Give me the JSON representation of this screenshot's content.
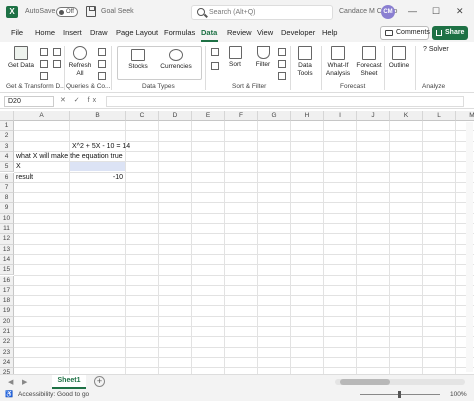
{
  "titlebar": {
    "autosave_label": "AutoSave",
    "autosave_state": "Off",
    "doc_title": "Goal Seek",
    "search_placeholder": "Search (Alt+Q)",
    "user_name": "Candace M Castro",
    "avatar_initials": "CM"
  },
  "tabs": [
    "File",
    "Home",
    "Insert",
    "Draw",
    "Page Layout",
    "Formulas",
    "Data",
    "Review",
    "View",
    "Developer",
    "Help"
  ],
  "active_tab": "Data",
  "actions": {
    "comments": "Comments",
    "share": "Share"
  },
  "ribbon": {
    "get_data": "Get Data",
    "refresh_all": "Refresh All",
    "stocks": "Stocks",
    "currencies": "Currencies",
    "sort": "Sort",
    "filter": "Filter",
    "data_tools": "Data Tools",
    "what_if": "What-If Analysis",
    "forecast_sheet": "Forecast Sheet",
    "outline": "Outline",
    "solver": "Solver",
    "groups": {
      "get_transform": "Get & Transform D...",
      "queries": "Queries & Co...",
      "data_types": "Data Types",
      "sort_filter": "Sort & Filter",
      "forecast": "Forecast",
      "analyze": "Analyze"
    }
  },
  "formula_bar": {
    "name_box": "D20",
    "content": ""
  },
  "columns": [
    "A",
    "B",
    "C",
    "D",
    "E",
    "F",
    "G",
    "H",
    "I",
    "J",
    "K",
    "L",
    "M"
  ],
  "rows": [
    "1",
    "2",
    "3",
    "4",
    "5",
    "6",
    "7",
    "8",
    "9",
    "10",
    "11",
    "12",
    "13",
    "14",
    "15",
    "16",
    "17",
    "18",
    "19",
    "20",
    "21",
    "22",
    "23",
    "24",
    "25"
  ],
  "cells": {
    "B3": "X^2 + 5X - 10 = 14",
    "A4": "what X will make the equation true",
    "A5": "X",
    "A6": "result",
    "B6": "-10"
  },
  "sheet_tab": "Sheet1",
  "status": {
    "accessibility": "Accessibility: Good to go",
    "zoom": "100%"
  },
  "colors": {
    "accent": "#1e7145",
    "selected_cell": "#dce3f5"
  }
}
